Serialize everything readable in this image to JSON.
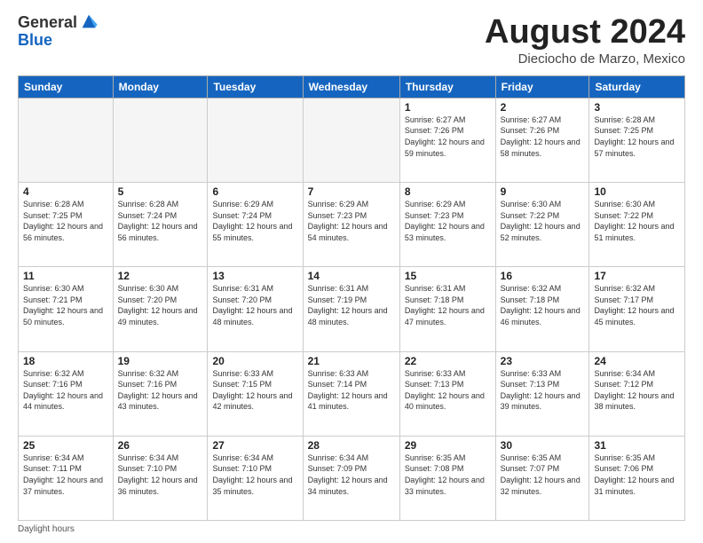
{
  "logo": {
    "general": "General",
    "blue": "Blue"
  },
  "header": {
    "month_year": "August 2024",
    "location": "Dieciocho de Marzo, Mexico"
  },
  "days_of_week": [
    "Sunday",
    "Monday",
    "Tuesday",
    "Wednesday",
    "Thursday",
    "Friday",
    "Saturday"
  ],
  "footer": {
    "daylight_label": "Daylight hours"
  },
  "weeks": [
    [
      {
        "day": "",
        "info": ""
      },
      {
        "day": "",
        "info": ""
      },
      {
        "day": "",
        "info": ""
      },
      {
        "day": "",
        "info": ""
      },
      {
        "day": "1",
        "info": "Sunrise: 6:27 AM\nSunset: 7:26 PM\nDaylight: 12 hours and 59 minutes."
      },
      {
        "day": "2",
        "info": "Sunrise: 6:27 AM\nSunset: 7:26 PM\nDaylight: 12 hours and 58 minutes."
      },
      {
        "day": "3",
        "info": "Sunrise: 6:28 AM\nSunset: 7:25 PM\nDaylight: 12 hours and 57 minutes."
      }
    ],
    [
      {
        "day": "4",
        "info": "Sunrise: 6:28 AM\nSunset: 7:25 PM\nDaylight: 12 hours and 56 minutes."
      },
      {
        "day": "5",
        "info": "Sunrise: 6:28 AM\nSunset: 7:24 PM\nDaylight: 12 hours and 56 minutes."
      },
      {
        "day": "6",
        "info": "Sunrise: 6:29 AM\nSunset: 7:24 PM\nDaylight: 12 hours and 55 minutes."
      },
      {
        "day": "7",
        "info": "Sunrise: 6:29 AM\nSunset: 7:23 PM\nDaylight: 12 hours and 54 minutes."
      },
      {
        "day": "8",
        "info": "Sunrise: 6:29 AM\nSunset: 7:23 PM\nDaylight: 12 hours and 53 minutes."
      },
      {
        "day": "9",
        "info": "Sunrise: 6:30 AM\nSunset: 7:22 PM\nDaylight: 12 hours and 52 minutes."
      },
      {
        "day": "10",
        "info": "Sunrise: 6:30 AM\nSunset: 7:22 PM\nDaylight: 12 hours and 51 minutes."
      }
    ],
    [
      {
        "day": "11",
        "info": "Sunrise: 6:30 AM\nSunset: 7:21 PM\nDaylight: 12 hours and 50 minutes."
      },
      {
        "day": "12",
        "info": "Sunrise: 6:30 AM\nSunset: 7:20 PM\nDaylight: 12 hours and 49 minutes."
      },
      {
        "day": "13",
        "info": "Sunrise: 6:31 AM\nSunset: 7:20 PM\nDaylight: 12 hours and 48 minutes."
      },
      {
        "day": "14",
        "info": "Sunrise: 6:31 AM\nSunset: 7:19 PM\nDaylight: 12 hours and 48 minutes."
      },
      {
        "day": "15",
        "info": "Sunrise: 6:31 AM\nSunset: 7:18 PM\nDaylight: 12 hours and 47 minutes."
      },
      {
        "day": "16",
        "info": "Sunrise: 6:32 AM\nSunset: 7:18 PM\nDaylight: 12 hours and 46 minutes."
      },
      {
        "day": "17",
        "info": "Sunrise: 6:32 AM\nSunset: 7:17 PM\nDaylight: 12 hours and 45 minutes."
      }
    ],
    [
      {
        "day": "18",
        "info": "Sunrise: 6:32 AM\nSunset: 7:16 PM\nDaylight: 12 hours and 44 minutes."
      },
      {
        "day": "19",
        "info": "Sunrise: 6:32 AM\nSunset: 7:16 PM\nDaylight: 12 hours and 43 minutes."
      },
      {
        "day": "20",
        "info": "Sunrise: 6:33 AM\nSunset: 7:15 PM\nDaylight: 12 hours and 42 minutes."
      },
      {
        "day": "21",
        "info": "Sunrise: 6:33 AM\nSunset: 7:14 PM\nDaylight: 12 hours and 41 minutes."
      },
      {
        "day": "22",
        "info": "Sunrise: 6:33 AM\nSunset: 7:13 PM\nDaylight: 12 hours and 40 minutes."
      },
      {
        "day": "23",
        "info": "Sunrise: 6:33 AM\nSunset: 7:13 PM\nDaylight: 12 hours and 39 minutes."
      },
      {
        "day": "24",
        "info": "Sunrise: 6:34 AM\nSunset: 7:12 PM\nDaylight: 12 hours and 38 minutes."
      }
    ],
    [
      {
        "day": "25",
        "info": "Sunrise: 6:34 AM\nSunset: 7:11 PM\nDaylight: 12 hours and 37 minutes."
      },
      {
        "day": "26",
        "info": "Sunrise: 6:34 AM\nSunset: 7:10 PM\nDaylight: 12 hours and 36 minutes."
      },
      {
        "day": "27",
        "info": "Sunrise: 6:34 AM\nSunset: 7:10 PM\nDaylight: 12 hours and 35 minutes."
      },
      {
        "day": "28",
        "info": "Sunrise: 6:34 AM\nSunset: 7:09 PM\nDaylight: 12 hours and 34 minutes."
      },
      {
        "day": "29",
        "info": "Sunrise: 6:35 AM\nSunset: 7:08 PM\nDaylight: 12 hours and 33 minutes."
      },
      {
        "day": "30",
        "info": "Sunrise: 6:35 AM\nSunset: 7:07 PM\nDaylight: 12 hours and 32 minutes."
      },
      {
        "day": "31",
        "info": "Sunrise: 6:35 AM\nSunset: 7:06 PM\nDaylight: 12 hours and 31 minutes."
      }
    ]
  ]
}
